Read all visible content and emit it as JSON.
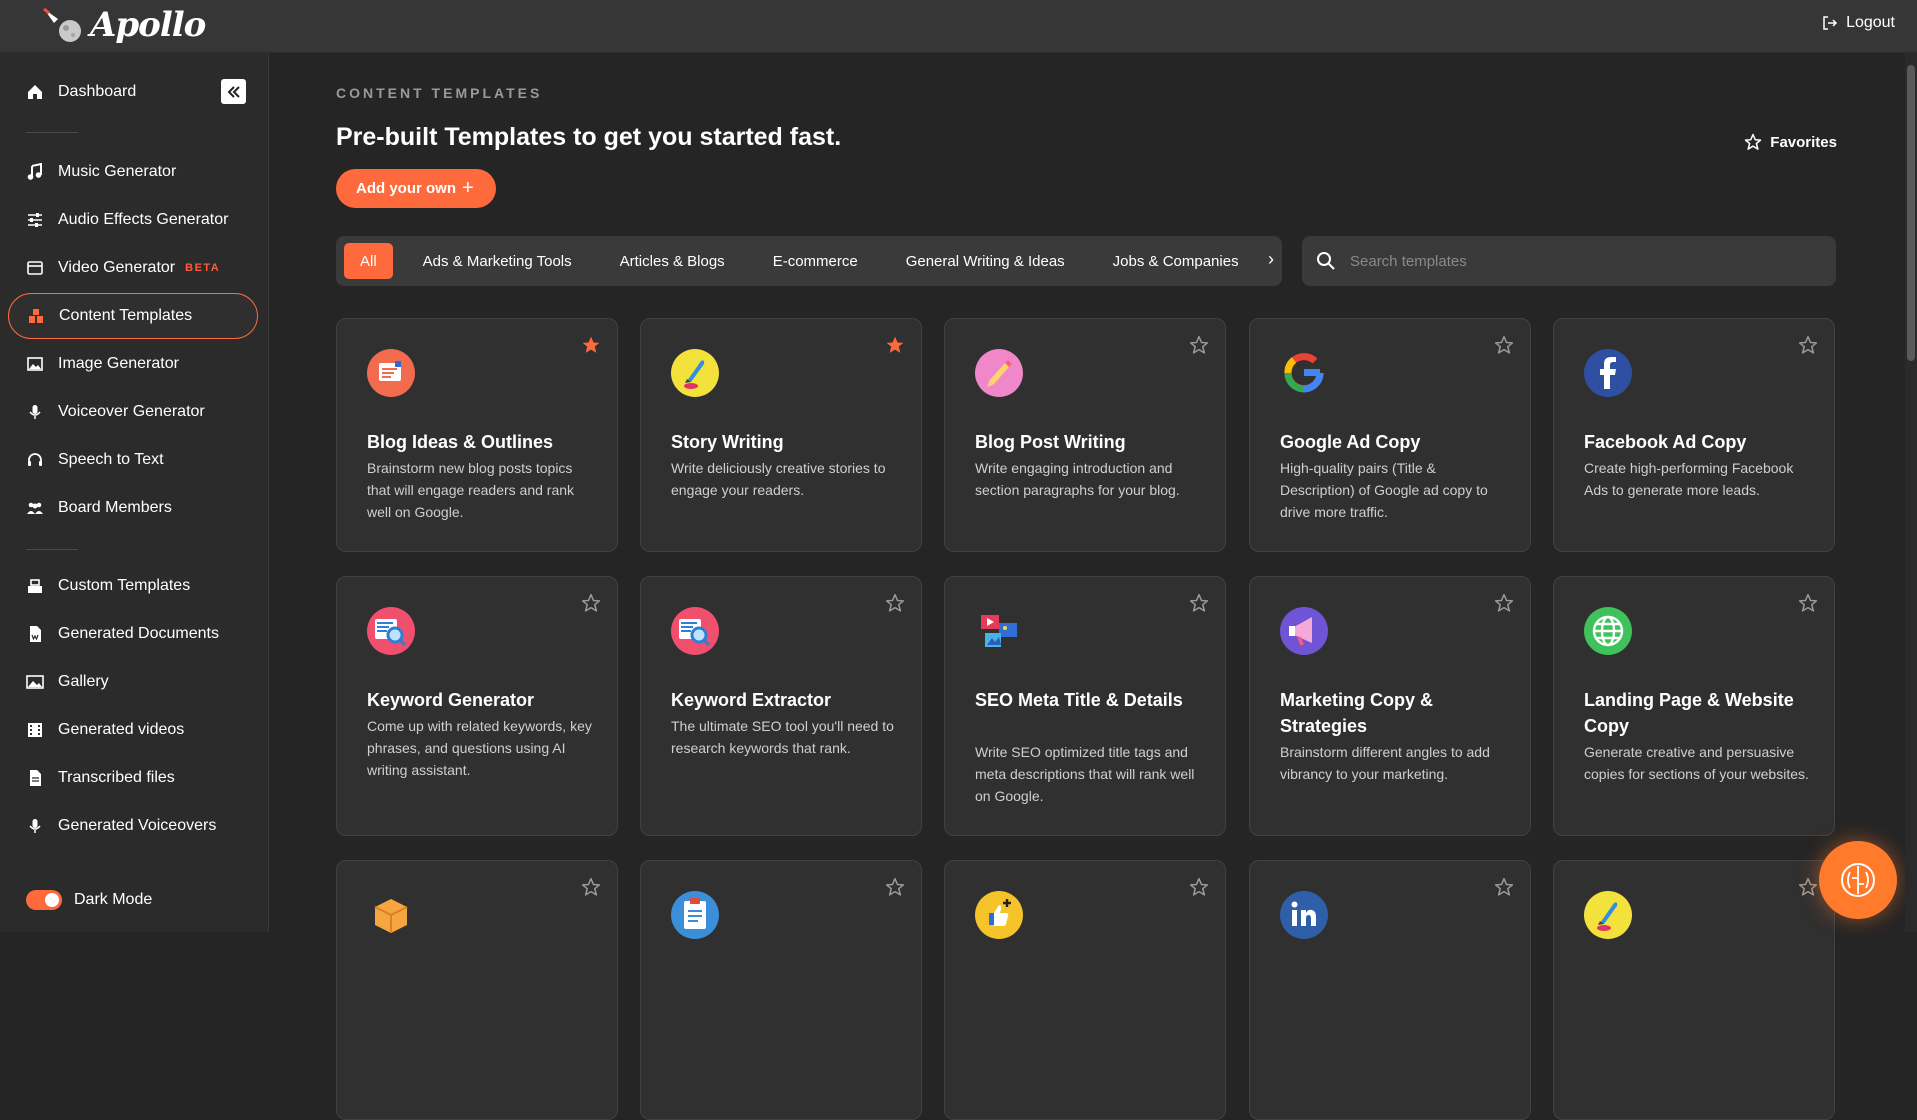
{
  "app": {
    "name": "Apollo"
  },
  "header": {
    "logout_label": "Logout"
  },
  "sidebar": {
    "items": [
      {
        "label": "Dashboard",
        "icon": "home-icon"
      },
      {
        "label": "Music Generator",
        "icon": "music-note-icon"
      },
      {
        "label": "Audio Effects Generator",
        "icon": "sliders-icon"
      },
      {
        "label": "Video Generator",
        "icon": "video-icon",
        "badge": "BETA"
      },
      {
        "label": "Content Templates",
        "icon": "templates-icon",
        "active": true
      },
      {
        "label": "Image Generator",
        "icon": "image-icon"
      },
      {
        "label": "Voiceover Generator",
        "icon": "microphone-icon"
      },
      {
        "label": "Speech to Text",
        "icon": "headset-icon"
      },
      {
        "label": "Board Members",
        "icon": "users-icon"
      },
      {
        "label": "Custom Templates",
        "icon": "custom-templates-icon"
      },
      {
        "label": "Generated Documents",
        "icon": "document-icon"
      },
      {
        "label": "Gallery",
        "icon": "gallery-icon"
      },
      {
        "label": "Generated videos",
        "icon": "film-icon"
      },
      {
        "label": "Transcribed files",
        "icon": "file-icon"
      },
      {
        "label": "Generated Voiceovers",
        "icon": "microphone-icon"
      }
    ],
    "dark_mode_label": "Dark Mode",
    "dark_mode_on": true
  },
  "main": {
    "kicker": "CONTENT TEMPLATES",
    "headline": "Pre-built Templates to get you started fast.",
    "favorites_label": "Favorites",
    "add_button_label": "Add your own",
    "tabs": [
      {
        "label": "All",
        "active": true
      },
      {
        "label": "Ads & Marketing Tools"
      },
      {
        "label": "Articles & Blogs"
      },
      {
        "label": "E-commerce"
      },
      {
        "label": "General Writing & Ideas"
      },
      {
        "label": "Jobs & Companies"
      }
    ],
    "search": {
      "placeholder": "Search templates"
    },
    "cards": [
      {
        "title": "Blog Ideas & Outlines",
        "desc": "Brainstorm new blog posts topics that will engage readers and rank well on Google.",
        "icon": "blog-ideas-icon",
        "favorite": true
      },
      {
        "title": "Story Writing",
        "desc": "Write deliciously creative stories to engage your readers.",
        "icon": "quill-icon",
        "favorite": true
      },
      {
        "title": "Blog Post Writing",
        "desc": "Write engaging introduction and section paragraphs for your blog.",
        "icon": "pencil-icon",
        "favorite": false
      },
      {
        "title": "Google Ad Copy",
        "desc": "High-quality pairs (Title & Description) of Google ad copy to drive more traffic.",
        "icon": "google-icon",
        "favorite": false
      },
      {
        "title": "Facebook Ad Copy",
        "desc": "Create high-performing Facebook Ads to generate more leads.",
        "icon": "facebook-icon",
        "favorite": false
      },
      {
        "title": "Keyword Generator",
        "desc": "Come up with related keywords, key phrases, and questions using AI writing assistant.",
        "icon": "keyword-search-icon",
        "favorite": false
      },
      {
        "title": "Keyword Extractor",
        "desc": "The ultimate SEO tool you'll need to research keywords that rank.",
        "icon": "keyword-search-icon",
        "favorite": false
      },
      {
        "title": "SEO Meta Title & Details",
        "desc": "Write SEO optimized title tags and meta descriptions that will rank well on Google.",
        "icon": "media-icon",
        "favorite": false
      },
      {
        "title": "Marketing Copy & Strategies",
        "desc": "Brainstorm different angles to add vibrancy to your marketing.",
        "icon": "megaphone-icon",
        "favorite": false
      },
      {
        "title": "Landing Page & Website Copy",
        "desc": "Generate creative and persuasive copies for sections of your websites.",
        "icon": "globe-icon",
        "favorite": false
      },
      {
        "title": "",
        "desc": "",
        "icon": "box-icon",
        "favorite": false
      },
      {
        "title": "",
        "desc": "",
        "icon": "clipboard-icon",
        "favorite": false
      },
      {
        "title": "",
        "desc": "",
        "icon": "thumbs-up-icon",
        "favorite": false
      },
      {
        "title": "",
        "desc": "",
        "icon": "linkedin-icon",
        "favorite": false
      },
      {
        "title": "",
        "desc": "",
        "icon": "quill-icon",
        "favorite": false
      }
    ]
  },
  "colors": {
    "accent": "#ff6a3d",
    "background": "#252525",
    "sidebar": "#2b2b2b",
    "card": "#303030"
  }
}
